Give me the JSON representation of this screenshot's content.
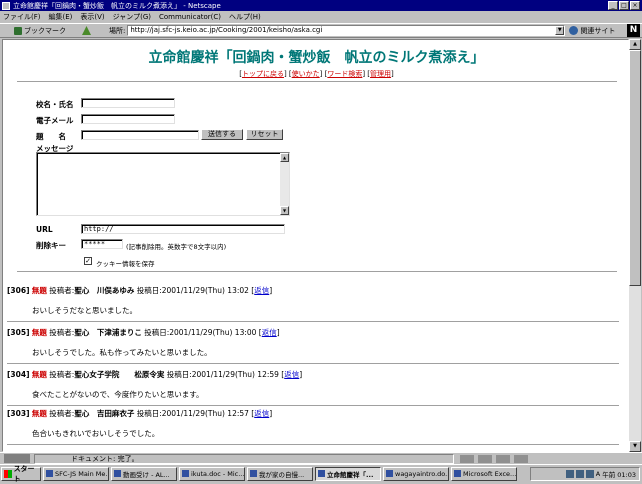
{
  "window": {
    "title": "立命館慶祥「回鍋肉・蟹炒飯　帆立のミルク煮添え」 - Netscape"
  },
  "menu": [
    "ファイル(F)",
    "編集(E)",
    "表示(V)",
    "ジャンプ(G)",
    "Communicator(C)",
    "ヘルプ(H)"
  ],
  "toolbar": {
    "bookmarks": "ブックマーク",
    "location_label": "場所:",
    "url": "http://jaj.sfc-js.keio.ac.jp/Cooking/2001/keisho/aska.cgi",
    "related": "関連サイト"
  },
  "page": {
    "title": "立命館慶祥「回鍋肉・蟹炒飯　帆立のミルク煮添え」",
    "nav": [
      "トップに戻る",
      "使いかた",
      "ワード検索",
      "管理用"
    ],
    "form": {
      "name_label": "校名・氏名",
      "email_label": "電子メール",
      "subject_label": "題　　名",
      "submit": "送信する",
      "reset": "リセット",
      "message_label": "メッセージ",
      "url_label": "URL",
      "url_value": "http://",
      "delkey_label": "削除キー",
      "delkey_value": "*****",
      "delkey_note": "(記事削除用。英数字で8文字以内)",
      "cookie_label": "クッキー情報を保存"
    },
    "posts": [
      {
        "num": "[306]",
        "subject": "無題",
        "by": "投稿者:",
        "author": "聖心　川俣あゆみ",
        "date": "投稿日:2001/11/29(Thu) 13:02",
        "reply": "返信",
        "body": "おいしそうだなと思いました。"
      },
      {
        "num": "[305]",
        "subject": "無題",
        "by": "投稿者:",
        "author": "聖心　下津浦まりこ",
        "date": "投稿日:2001/11/29(Thu) 13:00",
        "reply": "返信",
        "body": "おいしそうでした。私も作ってみたいと思いました。"
      },
      {
        "num": "[304]",
        "subject": "無題",
        "by": "投稿者:",
        "author": "聖心女子学院　　松原令実",
        "date": "投稿日:2001/11/29(Thu) 12:59",
        "reply": "返信",
        "body": "食べたことがないので、今度作りたいと思います。"
      },
      {
        "num": "[303]",
        "subject": "無題",
        "by": "投稿者:",
        "author": "聖心　吉田麻衣子",
        "date": "投稿日:2001/11/29(Thu) 12:57",
        "reply": "返信",
        "body": "色合いもきれいでおいしそうでした。"
      }
    ]
  },
  "status": {
    "text": "ドキュメント: 完了。"
  },
  "taskbar": {
    "start": "スタート",
    "tasks": [
      "SFC-JS Main Me...",
      "動画受け - AL...",
      "ikuta.doc - Mic...",
      "我が家の自慢...",
      "立命館慶祥「...",
      "wagayaintro.do...",
      "Microsoft Exce..."
    ],
    "clock": "午前 01:03",
    "ime": "A"
  }
}
